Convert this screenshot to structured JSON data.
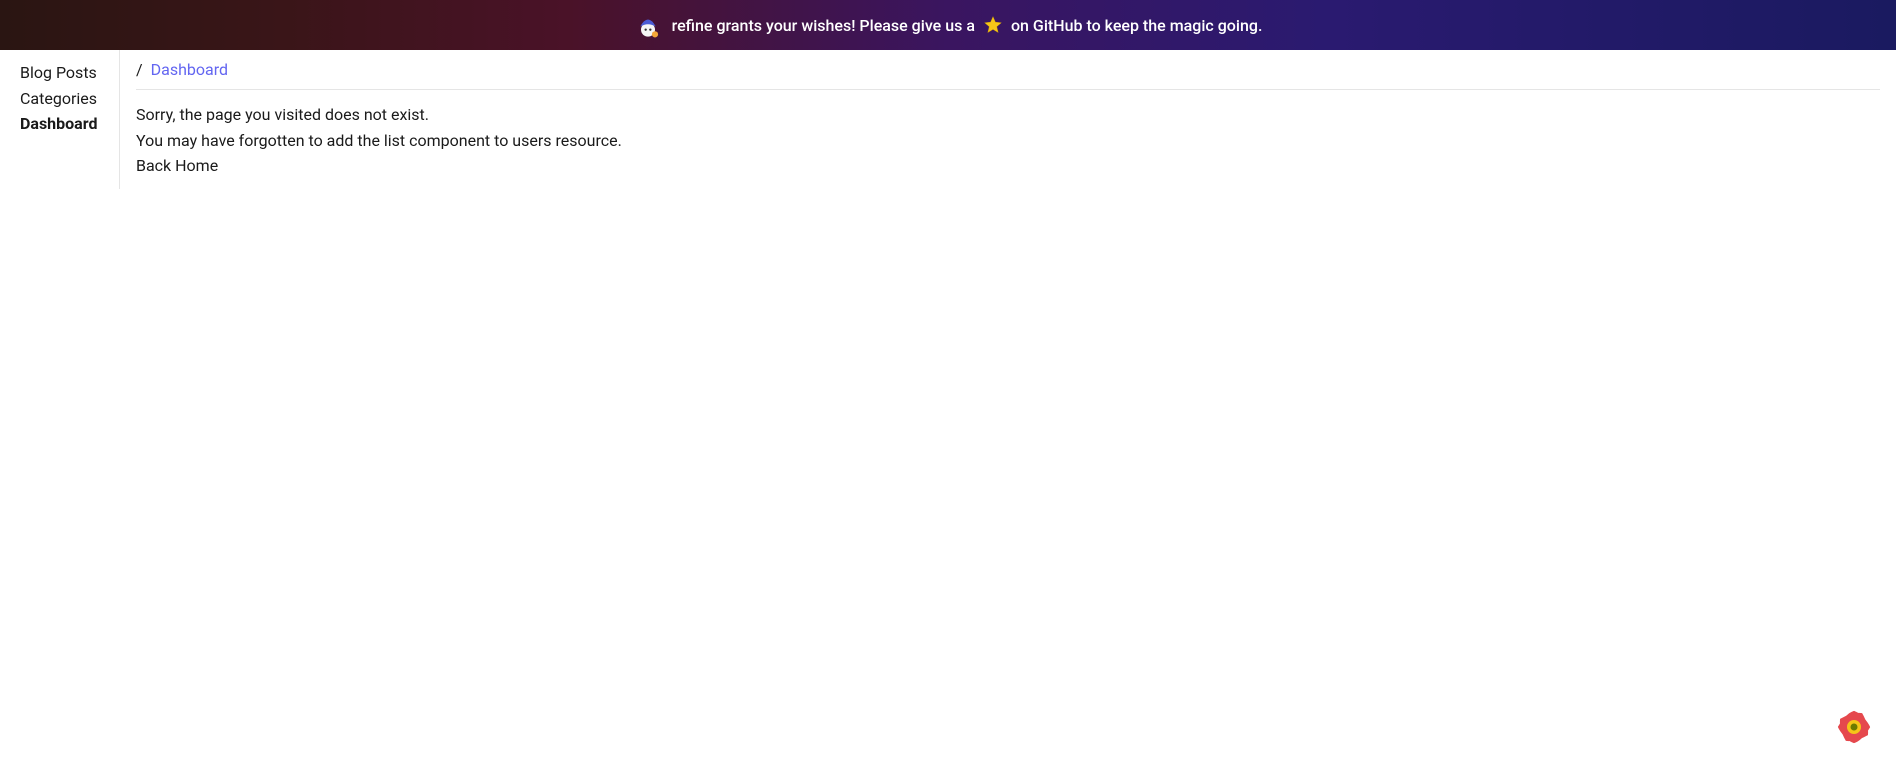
{
  "banner": {
    "text_before_star": "refine grants your wishes! Please give us a",
    "text_after_star": "on GitHub to keep the magic going."
  },
  "sidebar": {
    "items": [
      {
        "label": "Blog Posts",
        "active": false
      },
      {
        "label": "Categories",
        "active": false
      },
      {
        "label": "Dashboard",
        "active": true
      }
    ]
  },
  "breadcrumb": {
    "separator": "/",
    "current": "Dashboard"
  },
  "error": {
    "line1": "Sorry, the page you visited does not exist.",
    "line2": "You may have forgotten to add the list component to users resource.",
    "back_label": "Back Home"
  },
  "colors": {
    "link": "#6366f1"
  }
}
